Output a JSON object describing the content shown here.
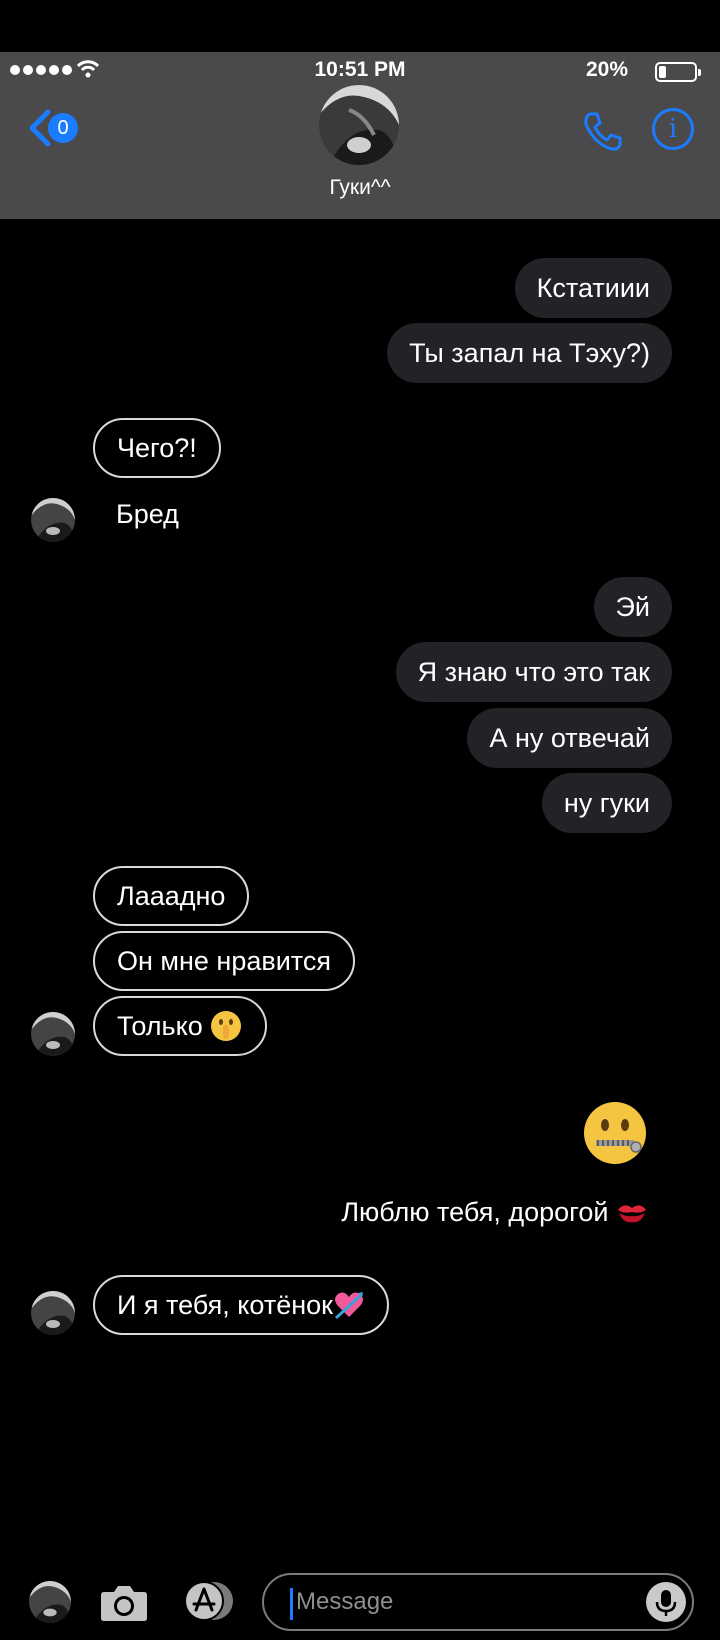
{
  "status": {
    "time": "10:51 PM",
    "battery": "20%",
    "battery_level": 0.2
  },
  "header": {
    "back_badge": "0",
    "contact_name": "Гуки^^"
  },
  "messages": {
    "m1": "Кстатиии",
    "m2": "Ты запал на Тэху?)",
    "m3": "Чего?!",
    "m4": "Бред",
    "m5": "Эй",
    "m6": "Я знаю что это так",
    "m7": "А ну отвечай",
    "m8": "ну гуки",
    "m9": "Лааадно",
    "m10": "Он мне нравится",
    "m11": "Только",
    "m13": "Люблю тебя, дорогой",
    "m14": "И я тебя, котёнок"
  },
  "emoji": {
    "shush": "shushing-face",
    "zipper": "zipper-mouth-face",
    "kiss": "kiss-mark",
    "heart": "heart-with-arrow"
  },
  "input": {
    "placeholder": "Message"
  },
  "colors": {
    "accent": "#1a7cff",
    "header_bg": "#4a4a4c",
    "outgoing_bubble": "#232227"
  }
}
